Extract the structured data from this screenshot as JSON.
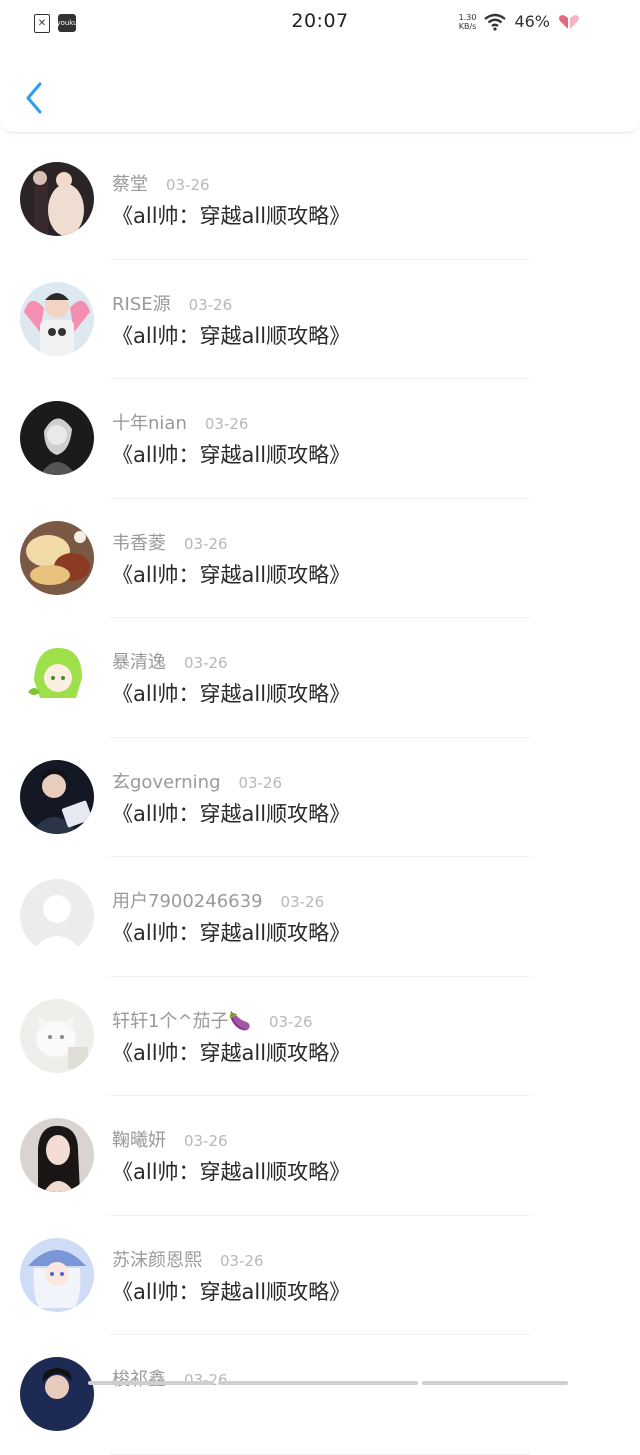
{
  "status_bar": {
    "time": "20:07",
    "net_speed_value": "1.30",
    "net_speed_unit": "KB/s",
    "battery": "46%",
    "youku_label": "youku"
  },
  "items": [
    {
      "name": "蔡堂",
      "date": "03-26",
      "title": "《all帅：穿越all顺攻略》"
    },
    {
      "name": "RISE源",
      "date": "03-26",
      "title": "《all帅：穿越all顺攻略》"
    },
    {
      "name": "十年nian",
      "date": "03-26",
      "title": "《all帅：穿越all顺攻略》"
    },
    {
      "name": "韦香菱",
      "date": "03-26",
      "title": "《all帅：穿越all顺攻略》"
    },
    {
      "name": "暴清逸",
      "date": "03-26",
      "title": "《all帅：穿越all顺攻略》"
    },
    {
      "name": "玄governing",
      "date": "03-26",
      "title": "《all帅：穿越all顺攻略》"
    },
    {
      "name": "用户7900246639",
      "date": "03-26",
      "title": "《all帅：穿越all顺攻略》"
    },
    {
      "name": "轩轩1个^茄子🍆",
      "date": "03-26",
      "title": "《all帅：穿越all顺攻略》"
    },
    {
      "name": "鞠曦妍",
      "date": "03-26",
      "title": "《all帅：穿越all顺攻略》"
    },
    {
      "name": "苏沫颜恩熙",
      "date": "03-26",
      "title": "《all帅：穿越all顺攻略》"
    },
    {
      "name": "梭祁鑫",
      "date": "03-26",
      "title": ""
    }
  ],
  "colors": {
    "accent": "#2a9df4",
    "name_text": "#9a9a9a",
    "title_text": "#2a2a2a"
  }
}
